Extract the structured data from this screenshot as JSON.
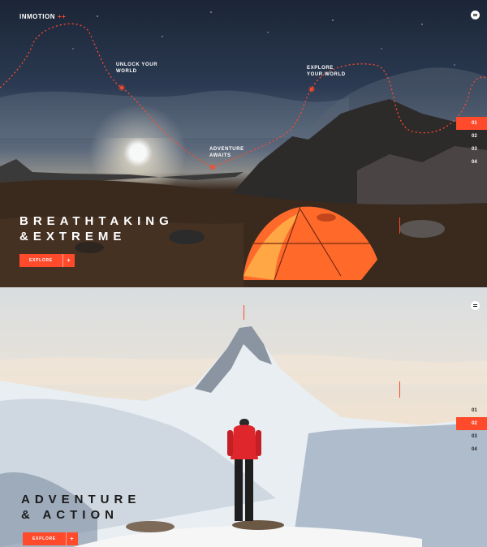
{
  "slide1": {
    "logo": {
      "text": "INMOTION",
      "accent": "++"
    },
    "hotspots": [
      {
        "label": "UNLOCK YOUR\nWORLD"
      },
      {
        "label": "ADVENTURE\nAWAITS"
      },
      {
        "label": "EXPLORE\nYOUR WORLD"
      }
    ],
    "pagination": [
      "01",
      "02",
      "03",
      "04"
    ],
    "active_page": "01",
    "headline": {
      "line1": "BREATHTAKING",
      "line2": "&EXTREME"
    },
    "button": {
      "label": "EXPLORE",
      "icon": "plus-icon"
    }
  },
  "slide2": {
    "pagination": [
      "01",
      "02",
      "03",
      "04"
    ],
    "active_page": "02",
    "headline": {
      "line1": "ADVENTURE",
      "line2": "& ACTION"
    },
    "button": {
      "label": "EXPLORE",
      "icon": "plus-icon"
    }
  },
  "colors": {
    "accent": "#ff4a2b",
    "white": "#ffffff",
    "dark": "#111111"
  }
}
